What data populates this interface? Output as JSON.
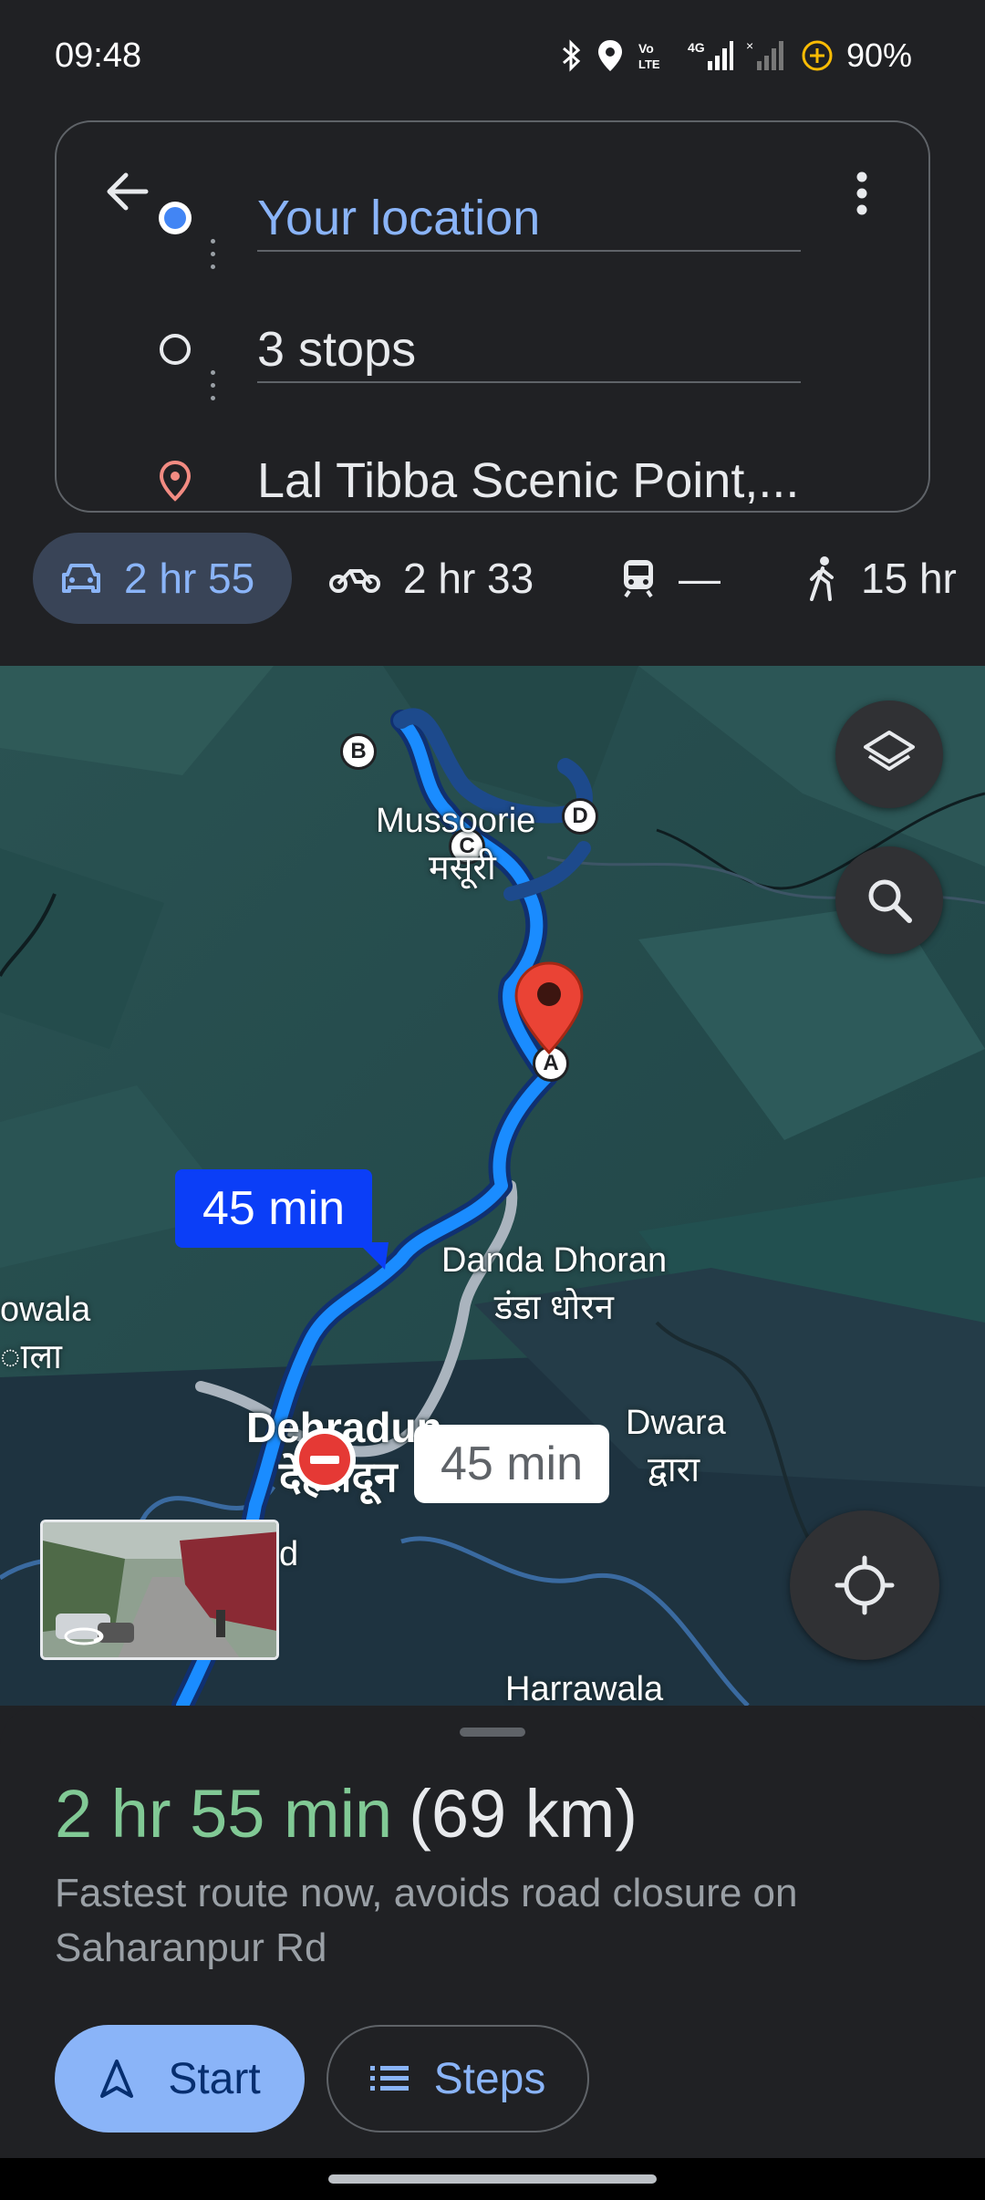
{
  "status_bar": {
    "time": "09:48",
    "battery": "90%",
    "icons": [
      "bluetooth-icon",
      "location-icon",
      "volte-icon",
      "4g-signal-icon",
      "signal-icon",
      "battery-saver-icon"
    ]
  },
  "directions": {
    "origin": "Your location",
    "stops": "3 stops",
    "destination": "Lal Tibba Scenic Point,..."
  },
  "modes": [
    {
      "name": "drive",
      "icon": "car-icon",
      "time": "2 hr 55",
      "selected": true
    },
    {
      "name": "two-wheeler",
      "icon": "motorbike-icon",
      "time": "2 hr 33"
    },
    {
      "name": "transit",
      "icon": "train-icon",
      "time": "—"
    },
    {
      "name": "walk",
      "icon": "walk-icon",
      "time": "15 hr"
    }
  ],
  "map": {
    "labels": {
      "mussoorie": "Mussoorie",
      "mussoorie_hi": "मसूरी",
      "danda_dhoran": "Danda Dhoran",
      "danda_dhoran_hi": "डंडा धोरन",
      "dehradun": "Dehradun",
      "dehradun_hi": "देहरादून",
      "dwara": "Dwara",
      "dwara_hi": "द्वारा",
      "harrawala": "Harrawala",
      "left_edge_1": "owala",
      "left_edge_2": "ाला",
      "small_d": "d"
    },
    "waypoints": [
      "A",
      "B",
      "C",
      "D"
    ],
    "route_time_primary": "45 min",
    "route_time_alt": "45 min",
    "colors": {
      "route": "#1a8cff",
      "route_alt": "#aab4be",
      "badge_primary": "#0b3ef7",
      "pin": "#ea4335"
    }
  },
  "summary": {
    "duration": "2 hr 55 min",
    "distance": "(69 km)",
    "description": "Fastest route now, avoids road closure on Saharanpur Rd"
  },
  "actions": {
    "start": "Start",
    "steps": "Steps"
  }
}
